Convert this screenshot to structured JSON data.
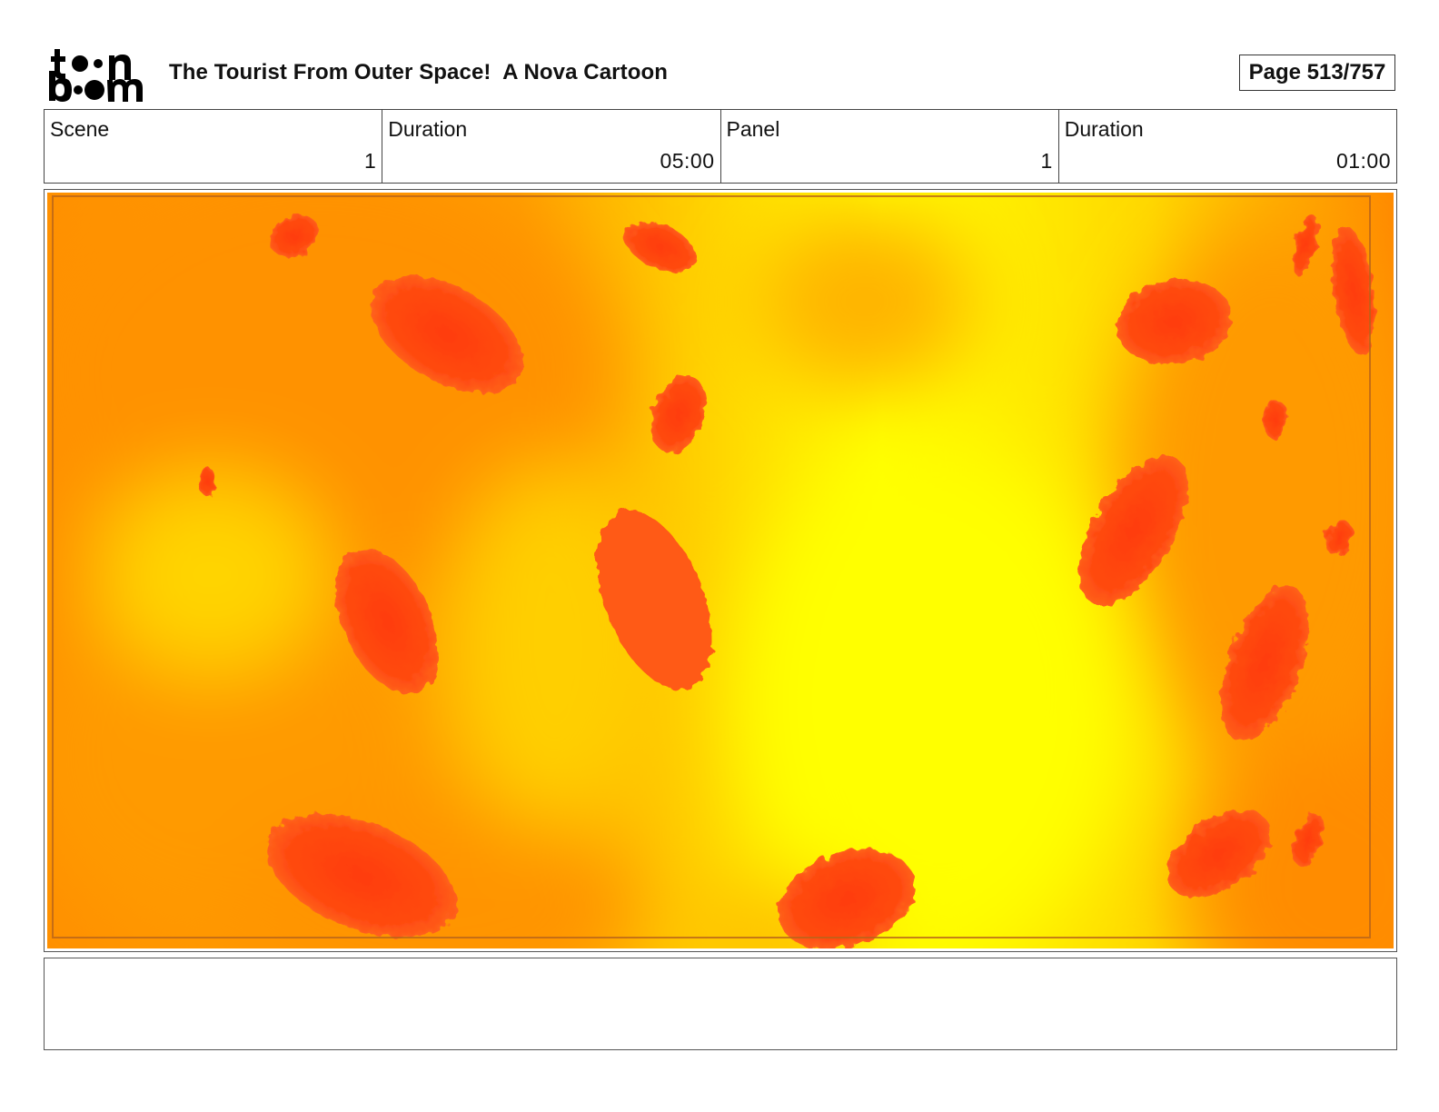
{
  "header": {
    "logo": {
      "text": "toon boom",
      "icon": "toon-boom-logo"
    },
    "title": "The Tourist From Outer Space!  A Nova Cartoon",
    "page": "Page 513/757"
  },
  "info": {
    "scene_label": "Scene",
    "scene_value": "1",
    "scene_duration_label": "Duration",
    "scene_duration_value": "05:00",
    "panel_label": "Panel",
    "panel_value": "1",
    "panel_duration_label": "Duration",
    "panel_duration_value": "01:00"
  },
  "panel": {
    "image": "lava-texture-panel",
    "colors": {
      "orange": "#ff8c00",
      "yellow": "#ffff00",
      "blob": "#ff3a10",
      "border": "#b8860b"
    }
  },
  "notes": {
    "text": ""
  }
}
